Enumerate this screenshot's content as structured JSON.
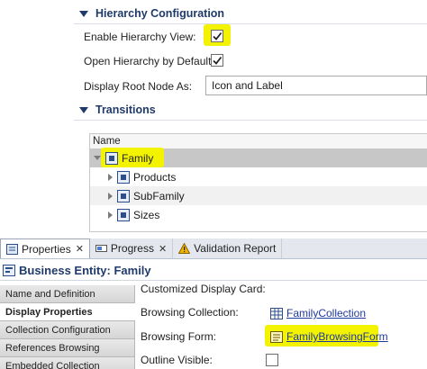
{
  "hierarchy_section": {
    "title": "Hierarchy Configuration",
    "enable_label": "Enable Hierarchy View:",
    "enable_checked": true,
    "open_label": "Open Hierarchy by Default:",
    "open_checked": true,
    "root_label": "Display Root Node As:",
    "root_value": "Icon and Label"
  },
  "transitions_section": {
    "title": "Transitions",
    "column_header": "Name",
    "nodes": [
      {
        "label": "Family",
        "expanded": true
      },
      {
        "label": "Products",
        "expanded": false
      },
      {
        "label": "SubFamily",
        "expanded": false
      },
      {
        "label": "Sizes",
        "expanded": false
      }
    ]
  },
  "tabs": [
    {
      "label": "Properties",
      "icon": "properties-icon"
    },
    {
      "label": "Progress",
      "icon": "progress-icon"
    },
    {
      "label": "Validation Report",
      "icon": "warning-icon"
    }
  ],
  "entity_title": "Business Entity: Family",
  "side_nav": [
    "Name and Definition",
    "Display Properties",
    "Collection Configuration",
    "References Browsing",
    "Embedded Collection"
  ],
  "properties": {
    "display_card_label": "Customized Display Card:",
    "browsing_collection_label": "Browsing Collection:",
    "browsing_collection_value": "FamilyCollection",
    "browsing_form_label": "Browsing Form:",
    "browsing_form_value": "FamilyBrowsingForm",
    "outline_label": "Outline Visible:",
    "outline_checked": false
  },
  "colors": {
    "highlight": "#f3f300",
    "header_text": "#1f3a6b",
    "link": "#1f3a9a"
  }
}
